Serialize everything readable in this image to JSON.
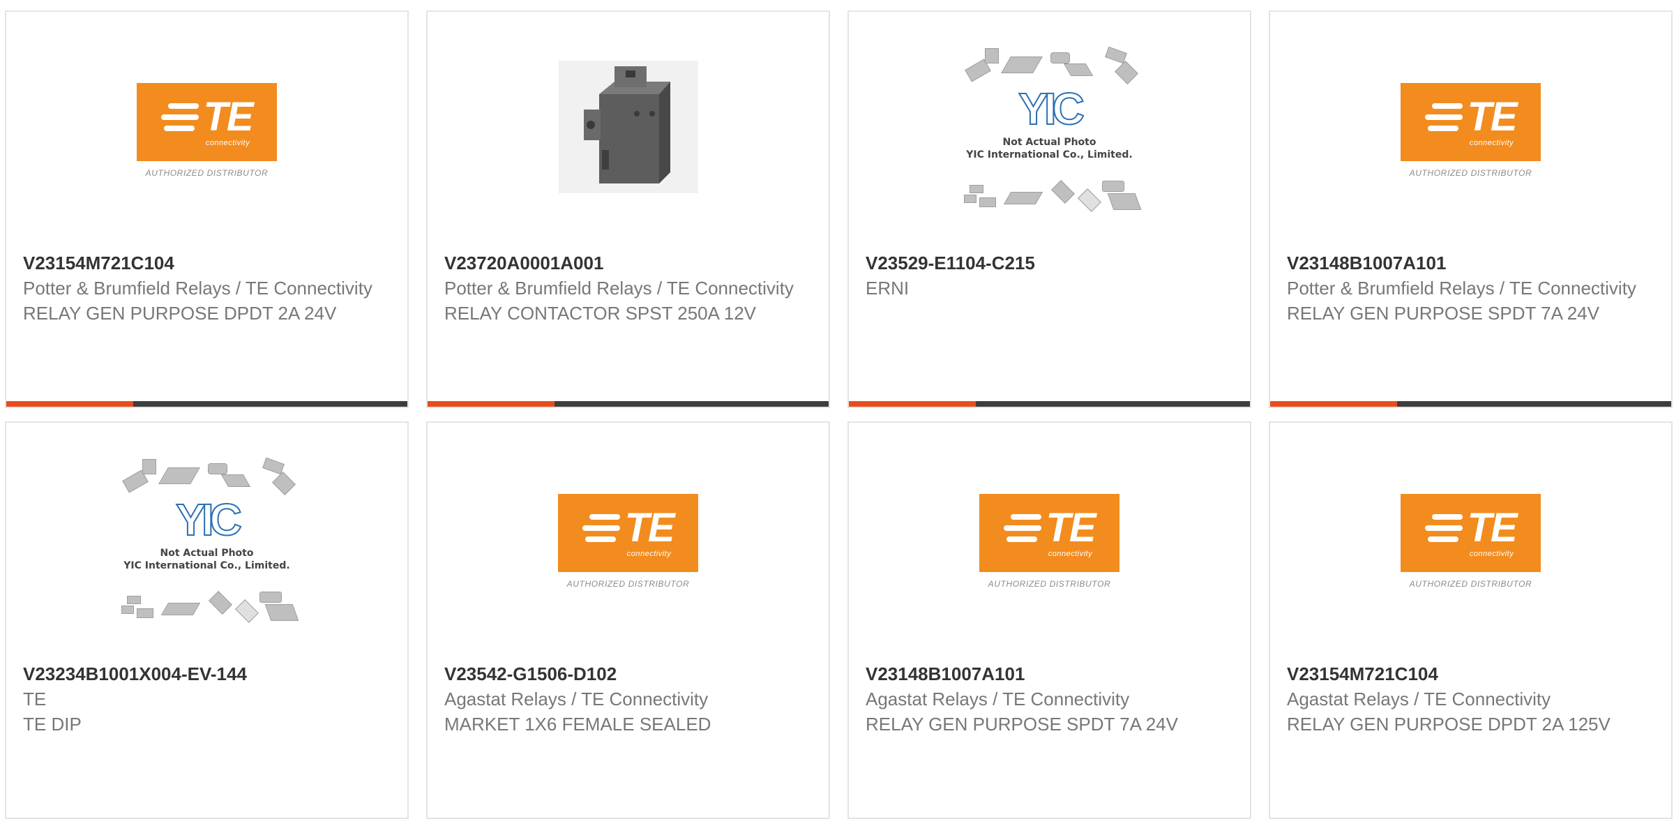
{
  "colors": {
    "accent": "#e84d1c",
    "bar_dark": "#3d3d3d",
    "te_orange": "#f28c1e"
  },
  "products": [
    {
      "image": "te-logo",
      "part_number": "V23154M721C104",
      "manufacturer": "Potter & Brumfield Relays / TE Connectivity",
      "description": "RELAY GEN PURPOSE DPDT 2A 24V"
    },
    {
      "image": "relay-photo",
      "part_number": "V23720A0001A001",
      "manufacturer": "Potter & Brumfield Relays / TE Connectivity",
      "description": "RELAY CONTACTOR SPST 250A 12V"
    },
    {
      "image": "yic-placeholder",
      "part_number": "V23529-E1104-C215",
      "manufacturer": "ERNI",
      "description": ""
    },
    {
      "image": "te-logo",
      "part_number": "V23148B1007A101",
      "manufacturer": "Potter & Brumfield Relays / TE Connectivity",
      "description": "RELAY GEN PURPOSE SPDT 7A 24V"
    },
    {
      "image": "yic-placeholder",
      "part_number": "V23234B1001X004-EV-144",
      "manufacturer": "TE",
      "description": "TE DIP"
    },
    {
      "image": "te-logo",
      "part_number": "V23542-G1506-D102",
      "manufacturer": "Agastat Relays / TE Connectivity",
      "description": "MARKET 1X6 FEMALE SEALED"
    },
    {
      "image": "te-logo",
      "part_number": "V23148B1007A101",
      "manufacturer": "Agastat Relays / TE Connectivity",
      "description": "RELAY GEN PURPOSE SPDT 7A 24V"
    },
    {
      "image": "te-logo",
      "part_number": "V23154M721C104",
      "manufacturer": "Agastat Relays / TE Connectivity",
      "description": "RELAY GEN PURPOSE DPDT 2A 125V"
    }
  ],
  "te_logo": {
    "letters": "TE",
    "sub": "connectivity",
    "authorized": "AUTHORIZED DISTRIBUTOR"
  },
  "yic": {
    "mark": "YIC",
    "line1": "Not Actual Photo",
    "line2": "YIC International Co., Limited."
  }
}
